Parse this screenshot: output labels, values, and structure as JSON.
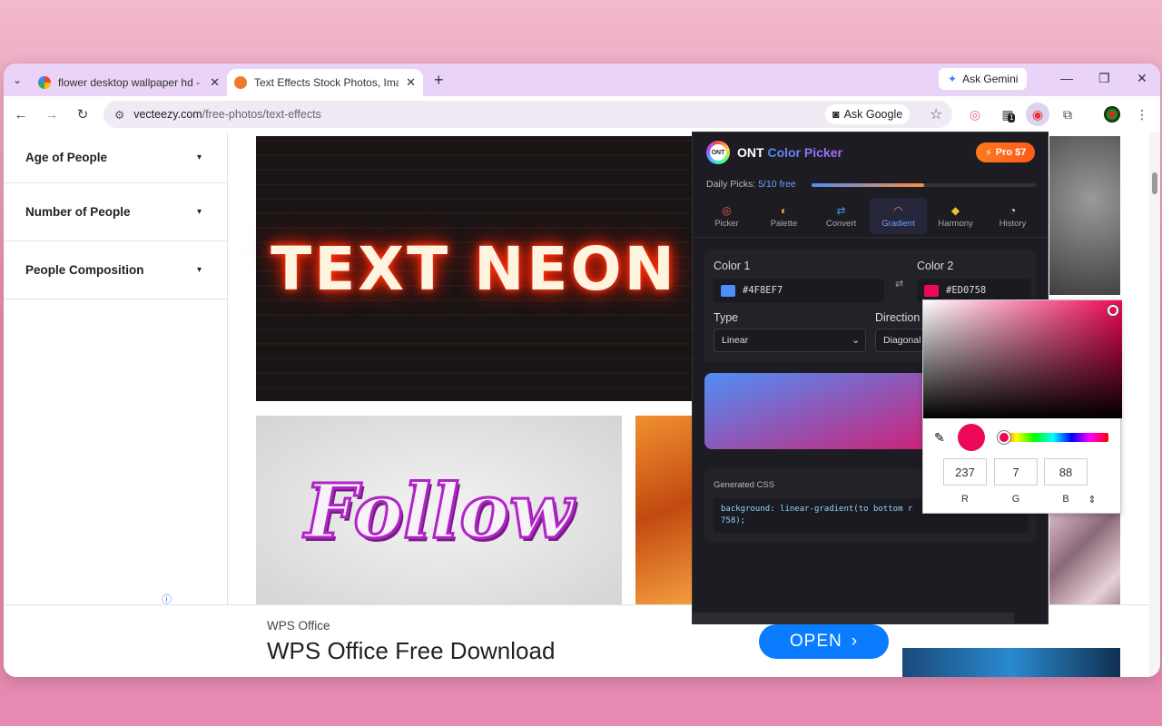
{
  "browser": {
    "tabs": [
      {
        "title": "flower desktop wallpaper hd - G",
        "favicon_color": "#4285f4"
      },
      {
        "title": "Text Effects Stock Photos, Imag",
        "favicon_color": "#f07a2a"
      }
    ],
    "ask_gemini": "Ask Gemini",
    "url_host": "vecteezy.com",
    "url_path": "/free-photos/text-effects",
    "ask_google": "Ask Google",
    "extension_badge": "1"
  },
  "sidebar": {
    "filters": [
      {
        "label": "Age of People"
      },
      {
        "label": "Number of People"
      },
      {
        "label": "People Composition"
      }
    ]
  },
  "images": {
    "neon_text": "TEXT NEON",
    "follow_text": "Follow"
  },
  "ad": {
    "brand": "WPS Office",
    "title": "WPS Office Free Download",
    "button": "OPEN"
  },
  "color_picker": {
    "logo": "ONT",
    "brand": "ONT",
    "brand_sub": "Color Picker",
    "pro_label": "Pro $7",
    "daily_label": "Daily Picks:",
    "daily_value": "5/10 free",
    "daily_fraction": 0.5,
    "tabs": [
      {
        "label": "Picker",
        "icon": "picker-icon"
      },
      {
        "label": "Palette",
        "icon": "palette-icon"
      },
      {
        "label": "Convert",
        "icon": "convert-icon"
      },
      {
        "label": "Gradient",
        "icon": "gradient-icon"
      },
      {
        "label": "Harmony",
        "icon": "harmony-icon"
      },
      {
        "label": "History",
        "icon": "history-icon"
      }
    ],
    "active_tab": "Gradient",
    "color1_label": "Color 1",
    "color1_value": "#4F8EF7",
    "color2_label": "Color 2",
    "color2_value": "#ED0758",
    "type_label": "Type",
    "type_value": "Linear",
    "direction_label": "Direction",
    "direction_value": "Diagonal",
    "css_label": "Generated CSS",
    "css_code_line1": "background: linear-gradient(to bottom r",
    "css_code_line2": "758);"
  },
  "native_picker": {
    "r": "237",
    "g": "7",
    "b": "88",
    "r_label": "R",
    "g_label": "G",
    "b_label": "B"
  }
}
